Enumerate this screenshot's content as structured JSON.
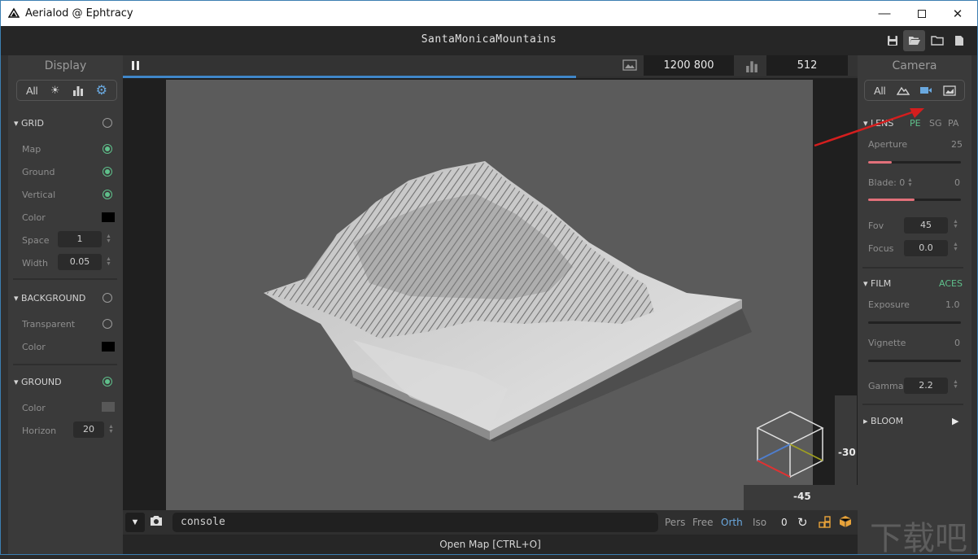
{
  "window": {
    "title": "Aerialod @ Ephtracy",
    "app_project": "SantaMonicaMountains"
  },
  "left_panel": {
    "title": "Display",
    "tabs": {
      "all": "All"
    },
    "grid": {
      "header": "GRID",
      "rows": {
        "map": "Map",
        "ground": "Ground",
        "vertical": "Vertical",
        "color": "Color",
        "space": "Space",
        "width": "Width"
      },
      "space_value": "1",
      "width_value": "0.05"
    },
    "background": {
      "header": "BACKGROUND",
      "transparent": "Transparent",
      "color": "Color"
    },
    "ground": {
      "header": "GROUND",
      "color": "Color",
      "horizon": "Horizon",
      "horizon_value": "20"
    }
  },
  "viewport": {
    "resolution": "1200  800",
    "samples": "512",
    "angle_vertical": "-30",
    "angle_horizontal": "-45",
    "progress": 0.62
  },
  "right_panel": {
    "title": "Camera",
    "tabs": {
      "all": "All"
    },
    "lens": {
      "header": "LENS",
      "modes": [
        "PE",
        "SG",
        "PA"
      ],
      "aperture_label": "Aperture",
      "aperture_value": "25",
      "aperture_fraction": 0.25,
      "blade_label": "Blade: 0",
      "blade_value": "0",
      "blade_fraction": 0.5,
      "fov_label": "Fov",
      "fov_value": "45",
      "focus_label": "Focus",
      "focus_value": "0.0"
    },
    "film": {
      "header": "FILM",
      "tonemap": "ACES",
      "exposure_label": "Exposure",
      "exposure_value": "1.0",
      "vignette_label": "Vignette",
      "vignette_value": "0",
      "gamma_label": "Gamma",
      "gamma_value": "2.2"
    },
    "bloom": {
      "header": "BLOOM"
    }
  },
  "bottom": {
    "console_text": "console",
    "modes": {
      "pers": "Pers",
      "free": "Free",
      "orth": "Orth",
      "iso": "Iso"
    },
    "counter": "0",
    "status": "Open Map [CTRL+O]"
  },
  "colors": {
    "accent_blue": "#3f86c9",
    "accent_green": "#5fc08b",
    "slider_pink": "#e2707a",
    "lens_mode_active": "#5fc08b"
  }
}
